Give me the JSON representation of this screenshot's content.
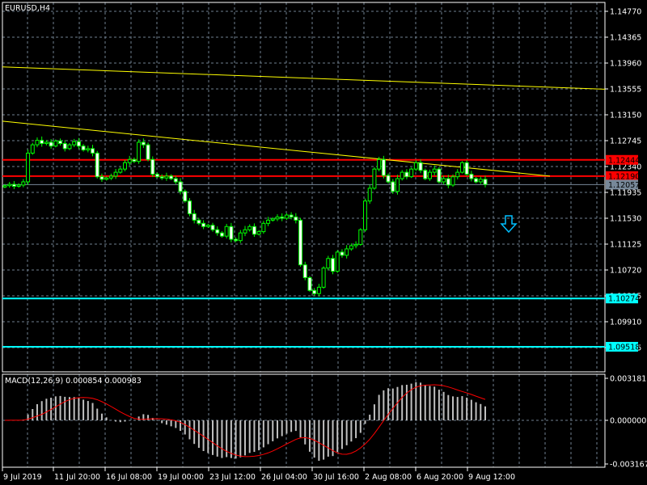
{
  "window": {
    "symbol_label": "EURUSD,H4"
  },
  "colors": {
    "bull_body": "#000000",
    "bear_body": "#ffffff",
    "wick": "#00ff00",
    "grid": "#708090",
    "trendline": "#ffff00",
    "resistance": "#ff0000",
    "support": "#00ffff",
    "bid": "#778899",
    "macd_hist": "#c0c0c0",
    "macd_signal": "#ff0000"
  },
  "chart_data": [
    {
      "type": "candlestick",
      "title": "EURUSD,H4",
      "ylim": [
        1.09505,
        1.1477
      ],
      "y_ticks": [
        "1.14770",
        "1.14365",
        "1.13960",
        "1.13555",
        "1.13150",
        "1.12745",
        "1.12340",
        "1.11935",
        "1.11530",
        "1.11125",
        "1.10720",
        "1.10315",
        "1.09910",
        "1.09505"
      ],
      "x_ticks": [
        "9 Jul 2019",
        "11 Jul 20:00",
        "16 Jul 08:00",
        "19 Jul 00:00",
        "23 Jul 12:00",
        "26 Jul 04:00",
        "30 Jul 16:00",
        "2 Aug 08:00",
        "6 Aug 20:00",
        "9 Aug 12:00"
      ],
      "closes": [
        1.1204,
        1.1206,
        1.1203,
        1.1205,
        1.121,
        1.1255,
        1.1268,
        1.1275,
        1.127,
        1.1272,
        1.1266,
        1.1274,
        1.127,
        1.1262,
        1.1268,
        1.1273,
        1.1266,
        1.126,
        1.1262,
        1.1255,
        1.1218,
        1.1214,
        1.1216,
        1.1219,
        1.1225,
        1.123,
        1.124,
        1.1245,
        1.1242,
        1.1272,
        1.1268,
        1.1245,
        1.1222,
        1.1218,
        1.1216,
        1.1219,
        1.1215,
        1.121,
        1.1195,
        1.118,
        1.116,
        1.115,
        1.1145,
        1.114,
        1.1142,
        1.1135,
        1.113,
        1.1125,
        1.114,
        1.112,
        1.1118,
        1.113,
        1.1135,
        1.114,
        1.1128,
        1.1132,
        1.1145,
        1.115,
        1.1152,
        1.1155,
        1.1153,
        1.1158,
        1.1155,
        1.115,
        1.108,
        1.106,
        1.104,
        1.1035,
        1.1045,
        1.1075,
        1.109,
        1.107,
        1.11,
        1.1095,
        1.1105,
        1.111,
        1.1112,
        1.1135,
        1.118,
        1.12,
        1.123,
        1.1245,
        1.122,
        1.121,
        1.1195,
        1.1215,
        1.1225,
        1.1218,
        1.123,
        1.124,
        1.1228,
        1.1215,
        1.1225,
        1.123,
        1.121,
        1.1215,
        1.1205,
        1.1218,
        1.1225,
        1.124,
        1.1222,
        1.1215,
        1.121,
        1.1214,
        1.1206
      ],
      "horizontal_levels": [
        {
          "name": "resistance-upper",
          "price": "1.12444",
          "value": 1.12444,
          "kind": "resistance"
        },
        {
          "name": "resistance-lower",
          "price": "1.12190",
          "value": 1.1219,
          "kind": "resistance"
        },
        {
          "name": "bid",
          "price": "1.12057",
          "value": 1.12057,
          "kind": "bid"
        },
        {
          "name": "support-upper",
          "price": "1.10274",
          "value": 1.10274,
          "kind": "support"
        },
        {
          "name": "support-lower",
          "price": "1.09518",
          "value": 1.09518,
          "kind": "support"
        }
      ],
      "trendlines": [
        {
          "from_price": 1.139,
          "to_price": 1.1355,
          "to_end": true
        },
        {
          "from_price": 1.1305,
          "to_price": 1.1219,
          "to_end": false
        }
      ],
      "annotations": [
        {
          "type": "arrow-down",
          "color": "#00bfff"
        }
      ]
    },
    {
      "type": "macd",
      "legend": "MACD(12,26,9) 0.000854 0.000983",
      "params": [
        12,
        26,
        9
      ],
      "last_main": 0.000854,
      "last_signal": 0.000983,
      "ylim": [
        -0.003167,
        0.003181
      ],
      "y_ticks": [
        "0.003181",
        "0.000000",
        "-0.003167"
      ]
    }
  ]
}
